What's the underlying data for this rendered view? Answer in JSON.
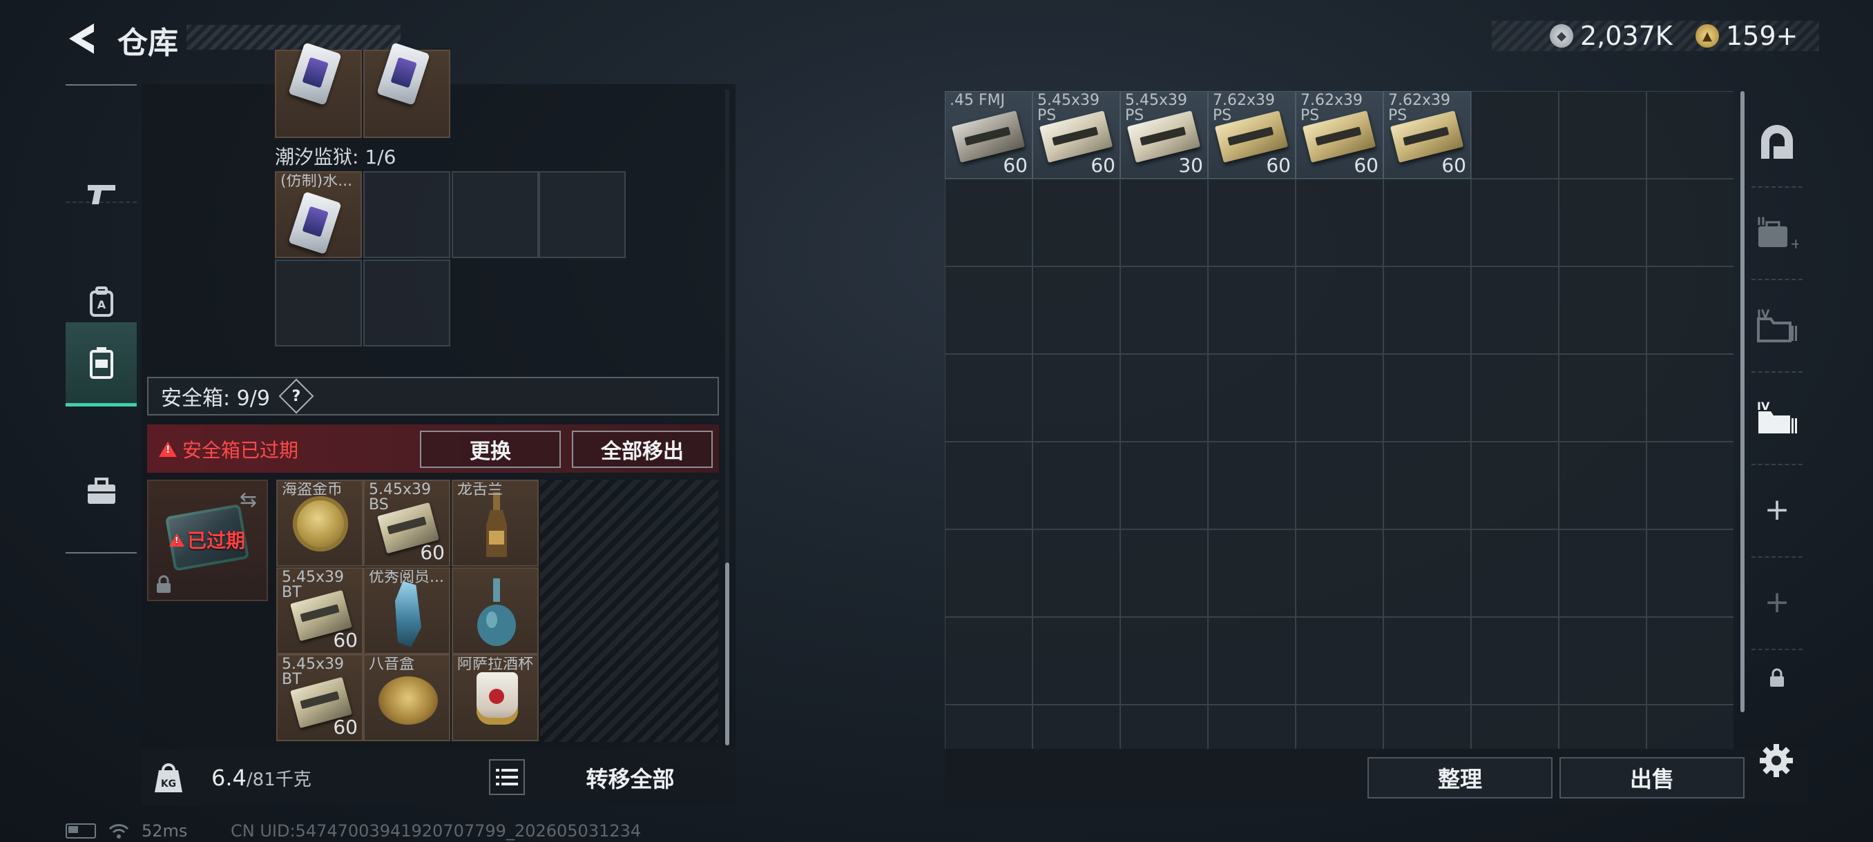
{
  "header": {
    "title": "仓库",
    "currency_silver": "2,037K",
    "currency_gold": "159+"
  },
  "nav": {
    "items": [
      {
        "id": "weapon",
        "icon": "pistol-icon"
      },
      {
        "id": "gear",
        "icon": "backpack-icon"
      },
      {
        "id": "container",
        "icon": "container-icon",
        "active": true
      },
      {
        "id": "toolbox",
        "icon": "toolbox-icon"
      }
    ]
  },
  "left": {
    "prison_label": "潮汐监狱: 1/6",
    "prison_item_label": "(仿制)水...",
    "safe_header": "安全箱: 9/9",
    "help": "?",
    "expired_warning": "安全箱已过期",
    "replace_btn": "更换",
    "remove_all_btn": "全部移出",
    "expired_tag": "已过期",
    "safe_items": [
      {
        "label": "海盗金币",
        "count": ""
      },
      {
        "label": "5.45x39 BS",
        "count": "60"
      },
      {
        "label": "龙舌兰",
        "count": ""
      },
      {
        "label": "5.45x39 BT",
        "count": "60"
      },
      {
        "label": "优秀阅员...",
        "count": ""
      },
      {
        "label": "",
        "count": ""
      },
      {
        "label": "5.45x39 BT",
        "count": "60"
      },
      {
        "label": "八音盒",
        "count": ""
      },
      {
        "label": "阿萨拉酒杯",
        "count": ""
      }
    ],
    "weight_value": "6.4",
    "weight_max": "/81千克",
    "transfer_all": "转移全部"
  },
  "stash": {
    "items": [
      {
        "label": ".45 FMJ",
        "count": "60",
        "style": "dark"
      },
      {
        "label": "5.45x39 PS",
        "count": "60",
        "style": "light"
      },
      {
        "label": "5.45x39 PS",
        "count": "30",
        "style": "light"
      },
      {
        "label": "7.62x39 PS",
        "count": "60",
        "style": "gold"
      },
      {
        "label": "7.62x39 PS",
        "count": "60",
        "style": "gold"
      },
      {
        "label": "7.62x39 PS",
        "count": "60",
        "style": "gold"
      }
    ],
    "sort_btn": "整理",
    "sell_btn": "出售"
  },
  "right_tabs": {
    "tab_labels": [
      "II",
      "IV",
      "IV"
    ],
    "plus": "+"
  },
  "status": {
    "ping": "52ms",
    "uid": "CN UID:54747003941920707799_202605031234"
  }
}
